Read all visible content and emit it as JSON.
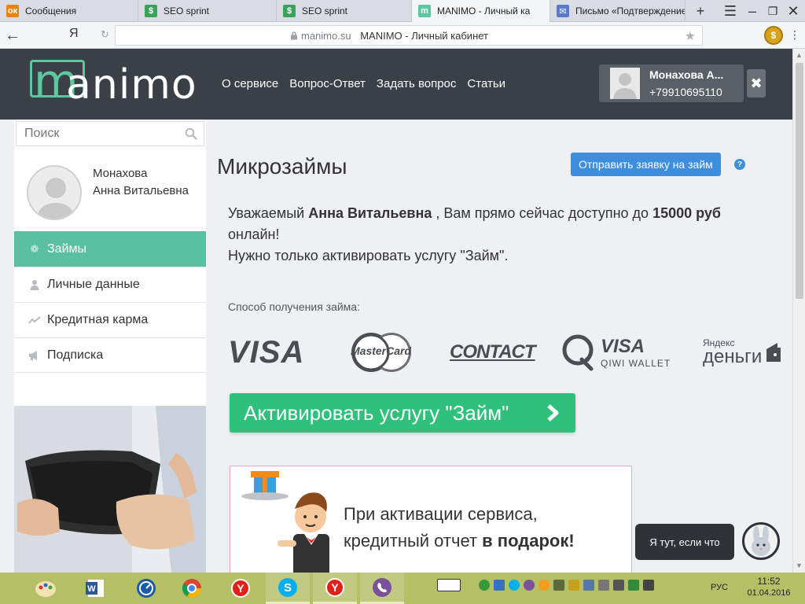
{
  "browser": {
    "tabs": [
      {
        "label": "Сообщения",
        "icon": "odnoklassniki-icon",
        "color": "#ee8208"
      },
      {
        "label": "SEO sprint",
        "icon": "seosprint-icon",
        "color": "#3aa35b"
      },
      {
        "label": "SEO sprint",
        "icon": "seosprint-icon",
        "color": "#3aa35b"
      },
      {
        "label": "MANIMO - Личный ка",
        "icon": "manimo-icon",
        "color": "#5cc7a0"
      },
      {
        "label": "Письмо «Подтверждение",
        "icon": "mail-icon",
        "color": "#5b79c9"
      }
    ],
    "new_tab": "+",
    "yandex_button": "Я",
    "url_domain": "manimo.su",
    "url_title": "MANIMO - Личный кабинет"
  },
  "header": {
    "logo_m": "m",
    "logo_rest": "animo",
    "nav": [
      "О сервисе",
      "Вопрос-Ответ",
      "Задать вопрос",
      "Статьи"
    ],
    "user_name": "Монахова А...",
    "user_phone": "+79910695110",
    "logout_symbol": "✖"
  },
  "sidebar": {
    "search_placeholder": "Поиск",
    "profile_name_line1": "Монахова",
    "profile_name_line2": "Анна Витальевна",
    "menu": [
      {
        "label": "Займы",
        "icon": "money-icon",
        "active": true
      },
      {
        "label": "Личные данные",
        "icon": "user-icon",
        "active": false
      },
      {
        "label": "Кредитная карма",
        "icon": "chart-icon",
        "active": false
      },
      {
        "label": "Подписка",
        "icon": "megaphone-icon",
        "active": false
      }
    ]
  },
  "main": {
    "title": "Микрозаймы",
    "apply_button": "Отправить заявку на займ",
    "help_symbol": "?",
    "offer": {
      "prefix": "Уважаемый ",
      "name": "Анна Витальевна",
      "middle": " , Вам прямо сейчас доступно до ",
      "amount": "15000 руб",
      "suffix": " онлайн!",
      "line2": "Нужно только активировать услугу \"Займ\"."
    },
    "method_label": "Способ получения займа:",
    "payment_logos": {
      "visa": "VISA",
      "mastercard": "MasterCard",
      "contact": "CONTACT",
      "qiwi_visa": "VISA",
      "qiwi_wallet": "QIWI WALLET",
      "yandex_small": "Яндекс",
      "yandex_money": "деньги"
    },
    "activate_button": "Активировать услугу \"Займ\"",
    "gift_line1": "При активации сервиса,",
    "gift_line2_prefix": "кредитный отчет ",
    "gift_line2_bold": "в подарок!"
  },
  "chat": {
    "text": "Я тут, если что"
  },
  "taskbar": {
    "apps": [
      "paint-icon",
      "word-icon",
      "speedtest-icon",
      "chrome-icon",
      "yandex-browser-icon",
      "skype-icon",
      "yandex-browser-icon",
      "viber-icon"
    ],
    "lang": "РУС",
    "time": "11:52",
    "date": "01.04.2016"
  },
  "colors": {
    "accent_green": "#5bc0a0",
    "activate_green": "#2fc07c",
    "button_blue": "#3d8ede",
    "header_dark": "#3b3f46",
    "taskbar": "#b4bf66"
  }
}
